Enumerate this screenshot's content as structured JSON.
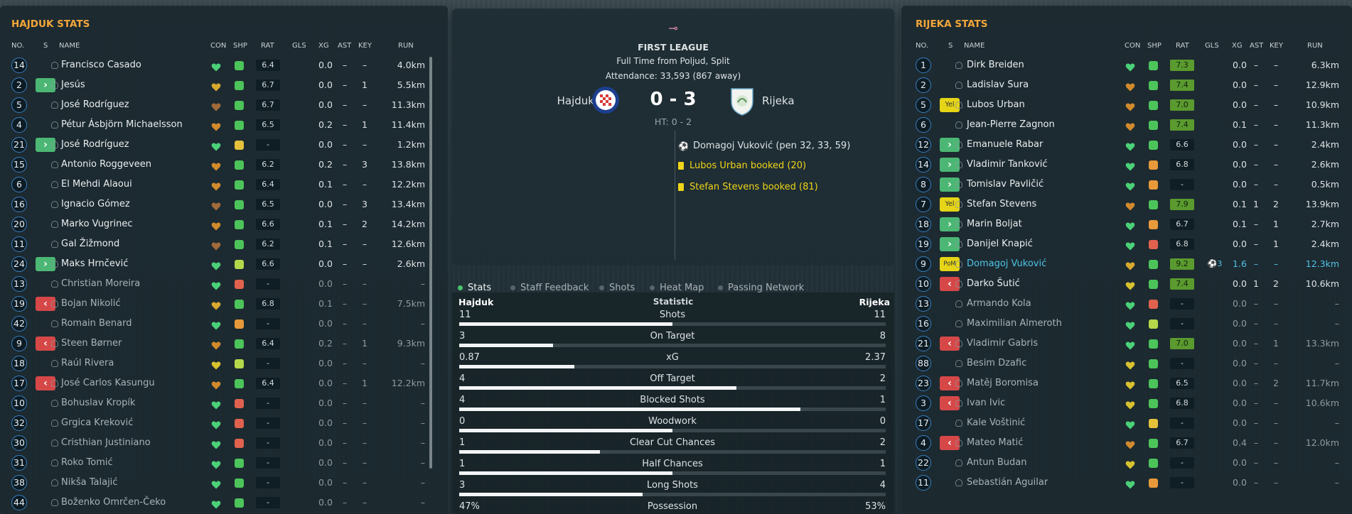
{
  "left": {
    "title": "HAJDUK STATS",
    "headers": {
      "no": "NO.",
      "s": "S",
      "name": "NAME",
      "con": "CON",
      "shp": "SHP",
      "rat": "RAT",
      "gls": "GLS",
      "xg": "XG",
      "ast": "AST",
      "key": "KEY",
      "run": "RUN"
    },
    "rows": [
      {
        "no": "14",
        "sub": "",
        "name": "Francisco Casado",
        "con": "#4bd178",
        "shp": "#4cc45a",
        "rat": "6.4",
        "gls": "",
        "xg": "0.0",
        "ast": "–",
        "key": "–",
        "run": "4.0km",
        "dim": false
      },
      {
        "no": "2",
        "sub": "in",
        "name": "Jesús",
        "con": "#d9a92f",
        "shp": "#4cc45a",
        "rat": "6.7",
        "gls": "",
        "xg": "0.0",
        "ast": "–",
        "key": "1",
        "run": "5.5km",
        "dim": false
      },
      {
        "no": "5",
        "sub": "",
        "name": "José Rodríguez",
        "con": "#a06a3a",
        "shp": "#4cc45a",
        "rat": "6.7",
        "gls": "",
        "xg": "0.0",
        "ast": "–",
        "key": "–",
        "run": "11.3km",
        "dim": false
      },
      {
        "no": "4",
        "sub": "",
        "name": "Pétur Ásbjörn Michaelsson",
        "con": "#d18a2c",
        "shp": "#4cc45a",
        "rat": "6.5",
        "gls": "",
        "xg": "0.2",
        "ast": "–",
        "key": "1",
        "run": "11.4km",
        "dim": false
      },
      {
        "no": "21",
        "sub": "in",
        "name": "José Rodríguez",
        "con": "#4bd178",
        "shp": "#e6c23b",
        "rat": "-",
        "gls": "",
        "xg": "0.0",
        "ast": "–",
        "key": "–",
        "run": "1.2km",
        "dim": false
      },
      {
        "no": "15",
        "sub": "",
        "name": "Antonio Roggeveen",
        "con": "#d18a2c",
        "shp": "#4cc45a",
        "rat": "6.2",
        "gls": "",
        "xg": "0.2",
        "ast": "–",
        "key": "3",
        "run": "13.8km",
        "dim": false
      },
      {
        "no": "6",
        "sub": "",
        "name": "El Mehdi Alaoui",
        "con": "#d18a2c",
        "shp": "#4cc45a",
        "rat": "6.4",
        "gls": "",
        "xg": "0.1",
        "ast": "–",
        "key": "–",
        "run": "12.2km",
        "dim": false
      },
      {
        "no": "16",
        "sub": "",
        "name": "Ignacio Gómez",
        "con": "#a06a3a",
        "shp": "#4cc45a",
        "rat": "6.5",
        "gls": "",
        "xg": "0.0",
        "ast": "–",
        "key": "3",
        "run": "13.4km",
        "dim": false
      },
      {
        "no": "20",
        "sub": "",
        "name": "Marko Vugrinec",
        "con": "#d18a2c",
        "shp": "#4cc45a",
        "rat": "6.6",
        "gls": "",
        "xg": "0.1",
        "ast": "–",
        "key": "2",
        "run": "14.2km",
        "dim": false
      },
      {
        "no": "11",
        "sub": "",
        "name": "Gal Žižmond",
        "con": "#a06a3a",
        "shp": "#4cc45a",
        "rat": "6.2",
        "gls": "",
        "xg": "0.1",
        "ast": "–",
        "key": "–",
        "run": "12.6km",
        "dim": false
      },
      {
        "no": "24",
        "sub": "in",
        "name": "Maks Hrnčević",
        "con": "#4bd178",
        "shp": "#b4d84a",
        "rat": "6.6",
        "gls": "",
        "xg": "0.0",
        "ast": "–",
        "key": "–",
        "run": "2.6km",
        "dim": false
      },
      {
        "no": "13",
        "sub": "",
        "name": "Christian Moreira",
        "con": "#4bd178",
        "shp": "#e0624e",
        "rat": "-",
        "gls": "",
        "xg": "0.0",
        "ast": "–",
        "key": "–",
        "run": "–",
        "dim": true
      },
      {
        "no": "19",
        "sub": "out",
        "name": "Bojan Nikolić",
        "con": "#d9a92f",
        "shp": "#4cc45a",
        "rat": "6.8",
        "gls": "",
        "xg": "0.1",
        "ast": "–",
        "key": "–",
        "run": "7.5km",
        "dim": true
      },
      {
        "no": "42",
        "sub": "",
        "name": "Romain Benard",
        "con": "#4bd178",
        "shp": "#e89a3a",
        "rat": "-",
        "gls": "",
        "xg": "0.0",
        "ast": "–",
        "key": "–",
        "run": "–",
        "dim": true
      },
      {
        "no": "9",
        "sub": "out",
        "name": "Steen Børner",
        "con": "#d18a2c",
        "shp": "#4cc45a",
        "rat": "6.4",
        "gls": "",
        "xg": "0.2",
        "ast": "–",
        "key": "1",
        "run": "9.3km",
        "dim": true
      },
      {
        "no": "18",
        "sub": "",
        "name": "Raúl Rivera",
        "con": "#d9c22f",
        "shp": "#b4d84a",
        "rat": "-",
        "gls": "",
        "xg": "0.0",
        "ast": "–",
        "key": "–",
        "run": "–",
        "dim": true
      },
      {
        "no": "17",
        "sub": "out",
        "name": "José Carlos Kasungu",
        "con": "#d18a2c",
        "shp": "#4cc45a",
        "rat": "6.4",
        "gls": "",
        "xg": "0.0",
        "ast": "–",
        "key": "1",
        "run": "12.2km",
        "dim": true
      },
      {
        "no": "10",
        "sub": "",
        "name": "Bohuslav Kropík",
        "con": "#4bd178",
        "shp": "#e0624e",
        "rat": "-",
        "gls": "",
        "xg": "0.0",
        "ast": "–",
        "key": "–",
        "run": "–",
        "dim": true
      },
      {
        "no": "32",
        "sub": "",
        "name": "Grgica Kreković",
        "con": "#4bd178",
        "shp": "#e0624e",
        "rat": "-",
        "gls": "",
        "xg": "0.0",
        "ast": "–",
        "key": "–",
        "run": "–",
        "dim": true
      },
      {
        "no": "30",
        "sub": "",
        "name": "Cristhian Justiniano",
        "con": "#4bd178",
        "shp": "#e0624e",
        "rat": "-",
        "gls": "",
        "xg": "0.0",
        "ast": "–",
        "key": "–",
        "run": "–",
        "dim": true
      },
      {
        "no": "31",
        "sub": "",
        "name": "Roko Tomić",
        "con": "#4bd178",
        "shp": "#4cc45a",
        "rat": "-",
        "gls": "",
        "xg": "0.0",
        "ast": "–",
        "key": "–",
        "run": "–",
        "dim": true
      },
      {
        "no": "38",
        "sub": "",
        "name": "Nikša Talajić",
        "con": "#4bd178",
        "shp": "#4cc45a",
        "rat": "-",
        "gls": "",
        "xg": "0.0",
        "ast": "–",
        "key": "–",
        "run": "–",
        "dim": true
      },
      {
        "no": "44",
        "sub": "",
        "name": "Boženko Omrčen-Čeko",
        "con": "#4bd178",
        "shp": "#4cc45a",
        "rat": "-",
        "gls": "",
        "xg": "0.0",
        "ast": "–",
        "key": "–",
        "run": "–",
        "dim": true
      }
    ]
  },
  "right": {
    "title": "RIJEKA STATS",
    "headers": {
      "no": "NO.",
      "s": "S",
      "name": "NAME",
      "con": "CON",
      "shp": "SHP",
      "rat": "RAT",
      "gls": "GLS",
      "xg": "XG",
      "ast": "AST",
      "key": "KEY",
      "run": "RUN"
    },
    "rows": [
      {
        "no": "1",
        "sub": "",
        "name": "Dirk Breiden",
        "con": "#4bd178",
        "shp": "#4cc45a",
        "rat": "7.3",
        "good": true,
        "gls": "",
        "xg": "0.0",
        "ast": "–",
        "key": "–",
        "run": "6.3km",
        "dim": false
      },
      {
        "no": "2",
        "sub": "",
        "name": "Ladislav Sura",
        "con": "#d18a2c",
        "shp": "#4cc45a",
        "rat": "7.4",
        "good": true,
        "gls": "",
        "xg": "0.0",
        "ast": "–",
        "key": "–",
        "run": "12.9km",
        "dim": false
      },
      {
        "no": "5",
        "sub": "yel",
        "subtext": "Yel",
        "name": "Lubos Urban",
        "con": "#d18a2c",
        "shp": "#4cc45a",
        "rat": "7.0",
        "good": true,
        "gls": "",
        "xg": "0.0",
        "ast": "–",
        "key": "–",
        "run": "10.9km",
        "dim": false
      },
      {
        "no": "6",
        "sub": "",
        "name": "Jean-Pierre Zagnon",
        "con": "#d18a2c",
        "shp": "#4cc45a",
        "rat": "7.4",
        "good": true,
        "gls": "",
        "xg": "0.1",
        "ast": "–",
        "key": "–",
        "run": "11.3km",
        "dim": false
      },
      {
        "no": "12",
        "sub": "in",
        "name": "Emanuele Rabar",
        "con": "#4bd178",
        "shp": "#4cc45a",
        "rat": "6.6",
        "good": false,
        "gls": "",
        "xg": "0.0",
        "ast": "–",
        "key": "–",
        "run": "2.4km",
        "dim": false
      },
      {
        "no": "14",
        "sub": "in",
        "name": "Vladimir Tanković",
        "con": "#4bd178",
        "shp": "#e89a3a",
        "rat": "6.8",
        "good": false,
        "gls": "",
        "xg": "0.0",
        "ast": "–",
        "key": "–",
        "run": "2.6km",
        "dim": false
      },
      {
        "no": "8",
        "sub": "in",
        "name": "Tomislav Pavličić",
        "con": "#4bd178",
        "shp": "#e89a3a",
        "rat": "-",
        "good": false,
        "gls": "",
        "xg": "0.0",
        "ast": "–",
        "key": "–",
        "run": "0.5km",
        "dim": false
      },
      {
        "no": "7",
        "sub": "yel",
        "subtext": "Yel",
        "name": "Stefan Stevens",
        "con": "#d18a2c",
        "shp": "#4cc45a",
        "rat": "7.9",
        "good": true,
        "gls": "",
        "xg": "0.1",
        "ast": "1",
        "key": "2",
        "run": "13.9km",
        "dim": false
      },
      {
        "no": "18",
        "sub": "in",
        "name": "Marin Boljat",
        "con": "#4bd178",
        "shp": "#e89a3a",
        "rat": "6.7",
        "good": false,
        "gls": "",
        "xg": "0.1",
        "ast": "–",
        "key": "1",
        "run": "2.7km",
        "dim": false
      },
      {
        "no": "19",
        "sub": "in",
        "name": "Danijel Knapić",
        "con": "#4bd178",
        "shp": "#e0624e",
        "rat": "6.8",
        "good": false,
        "gls": "",
        "xg": "0.0",
        "ast": "–",
        "key": "1",
        "run": "2.4km",
        "dim": false
      },
      {
        "no": "9",
        "sub": "pom",
        "subtext": "PoM",
        "name": "Domagoj Vuković",
        "con": "#d9a92f",
        "shp": "#4cc45a",
        "rat": "9.2",
        "good": true,
        "gls": "3",
        "xg": "1.6",
        "ast": "–",
        "key": "–",
        "run": "12.3km",
        "dim": false,
        "hl": true
      },
      {
        "no": "10",
        "sub": "out",
        "name": "Darko Šutić",
        "con": "#d9c22f",
        "shp": "#4cc45a",
        "rat": "7.4",
        "good": true,
        "gls": "",
        "xg": "0.0",
        "ast": "1",
        "key": "2",
        "run": "10.6km",
        "dim": false
      },
      {
        "no": "13",
        "sub": "",
        "name": "Armando Kola",
        "con": "#4bd178",
        "shp": "#e0624e",
        "rat": "-",
        "good": false,
        "gls": "",
        "xg": "0.0",
        "ast": "–",
        "key": "–",
        "run": "–",
        "dim": true
      },
      {
        "no": "16",
        "sub": "",
        "name": "Maximilian Almeroth",
        "con": "#4bd178",
        "shp": "#b4d84a",
        "rat": "-",
        "good": false,
        "gls": "",
        "xg": "0.0",
        "ast": "–",
        "key": "–",
        "run": "–",
        "dim": true
      },
      {
        "no": "21",
        "sub": "out",
        "name": "Vladimir Gabris",
        "con": "#4bd178",
        "shp": "#4cc45a",
        "rat": "7.0",
        "good": true,
        "gls": "",
        "xg": "0.0",
        "ast": "–",
        "key": "1",
        "run": "13.3km",
        "dim": true
      },
      {
        "no": "88",
        "sub": "",
        "name": "Besim Dzafic",
        "con": "#d9c22f",
        "shp": "#4cc45a",
        "rat": "-",
        "good": false,
        "gls": "",
        "xg": "0.0",
        "ast": "–",
        "key": "–",
        "run": "–",
        "dim": true
      },
      {
        "no": "23",
        "sub": "out",
        "name": "Matěj Boromisa",
        "con": "#d9c22f",
        "shp": "#4cc45a",
        "rat": "6.5",
        "good": false,
        "gls": "",
        "xg": "0.0",
        "ast": "–",
        "key": "2",
        "run": "11.7km",
        "dim": true
      },
      {
        "no": "3",
        "sub": "out",
        "name": "Ivan Ivic",
        "con": "#d9c22f",
        "shp": "#4cc45a",
        "rat": "6.8",
        "good": false,
        "gls": "",
        "xg": "0.0",
        "ast": "–",
        "key": "–",
        "run": "10.6km",
        "dim": true
      },
      {
        "no": "17",
        "sub": "",
        "name": "Kale Voštinić",
        "con": "#4bd178",
        "shp": "#e6c23b",
        "rat": "-",
        "good": false,
        "gls": "",
        "xg": "0.0",
        "ast": "–",
        "key": "–",
        "run": "–",
        "dim": true
      },
      {
        "no": "4",
        "sub": "out",
        "name": "Mateo Matić",
        "con": "#d18a2c",
        "shp": "#4cc45a",
        "rat": "6.7",
        "good": false,
        "gls": "",
        "xg": "0.4",
        "ast": "–",
        "key": "–",
        "run": "12.0km",
        "dim": true
      },
      {
        "no": "22",
        "sub": "",
        "name": "Antun Budan",
        "con": "#d9c22f",
        "shp": "#4cc45a",
        "rat": "-",
        "good": false,
        "gls": "",
        "xg": "0.0",
        "ast": "–",
        "key": "–",
        "run": "–",
        "dim": true
      },
      {
        "no": "11",
        "sub": "",
        "name": "Sebastián Aguilar",
        "con": "#4bd178",
        "shp": "#e89a3a",
        "rat": "-",
        "good": false,
        "gls": "",
        "xg": "0.0",
        "ast": "–",
        "key": "–",
        "run": "–",
        "dim": true
      }
    ]
  },
  "match": {
    "competition": "FIRST LEAGUE",
    "venue": "Full Time from Poljud, Split",
    "attendance": "Attendance: 33,593 (867 away)",
    "home": "Hajduk",
    "away": "Rijeka",
    "score": "0 - 3",
    "halftime": "HT: 0 - 2",
    "events": [
      {
        "type": "goal",
        "text": "Domagoj Vuković (pen 32, 33, 59)"
      },
      {
        "type": "card",
        "text": "Lubos Urban booked (20)"
      },
      {
        "type": "card",
        "text": "Stefan Stevens booked (81)"
      }
    ]
  },
  "tabs": [
    "Stats",
    "Staff Feedback",
    "Shots",
    "Heat Map",
    "Passing Network"
  ],
  "stats": {
    "home": "Hajduk",
    "label": "Statistic",
    "away": "Rijeka",
    "rows": [
      {
        "name": "Shots",
        "home": "11",
        "away": "11",
        "share": 0.5
      },
      {
        "name": "On Target",
        "home": "3",
        "away": "8",
        "share": 0.22
      },
      {
        "name": "xG",
        "home": "0.87",
        "away": "2.37",
        "share": 0.27
      },
      {
        "name": "Off Target",
        "home": "4",
        "away": "2",
        "share": 0.65
      },
      {
        "name": "Blocked Shots",
        "home": "4",
        "away": "1",
        "share": 0.8
      },
      {
        "name": "Woodwork",
        "home": "0",
        "away": "0",
        "share": 0.5
      },
      {
        "name": "Clear Cut Chances",
        "home": "1",
        "away": "2",
        "share": 0.33
      },
      {
        "name": "Half Chances",
        "home": "1",
        "away": "1",
        "share": 0.5
      },
      {
        "name": "Long Shots",
        "home": "3",
        "away": "4",
        "share": 0.43
      },
      {
        "name": "Possession",
        "home": "47%",
        "away": "53%",
        "share": 0.47
      }
    ]
  }
}
